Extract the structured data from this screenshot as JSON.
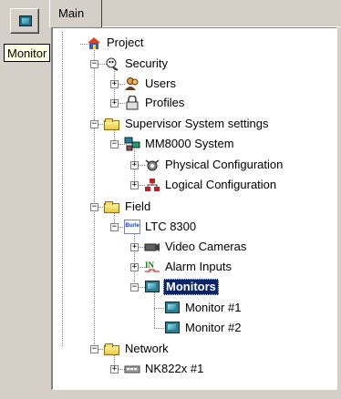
{
  "toolbar": {
    "monitor_button_icon": "monitor-icon",
    "tooltip": "Monitor"
  },
  "tabs": {
    "main": "Main"
  },
  "tree": {
    "project": "Project",
    "security": "Security",
    "users": "Users",
    "profiles": "Profiles",
    "supervisor": "Supervisor System settings",
    "mm8000": "MM8000 System",
    "physical": "Physical Configuration",
    "logical": "Logical Configuration",
    "field": "Field",
    "ltc": "LTC 8300",
    "ltc_badge": "Burle",
    "video": "Video Cameras",
    "alarm": "Alarm Inputs",
    "alarm_badge": "IN",
    "monitors": "Monitors",
    "monitor1": "Monitor #1",
    "monitor2": "Monitor #2",
    "network": "Network",
    "nk": "NK822x #1"
  },
  "colors": {
    "selection": "#0a246a",
    "background": "#d4d0c8"
  }
}
